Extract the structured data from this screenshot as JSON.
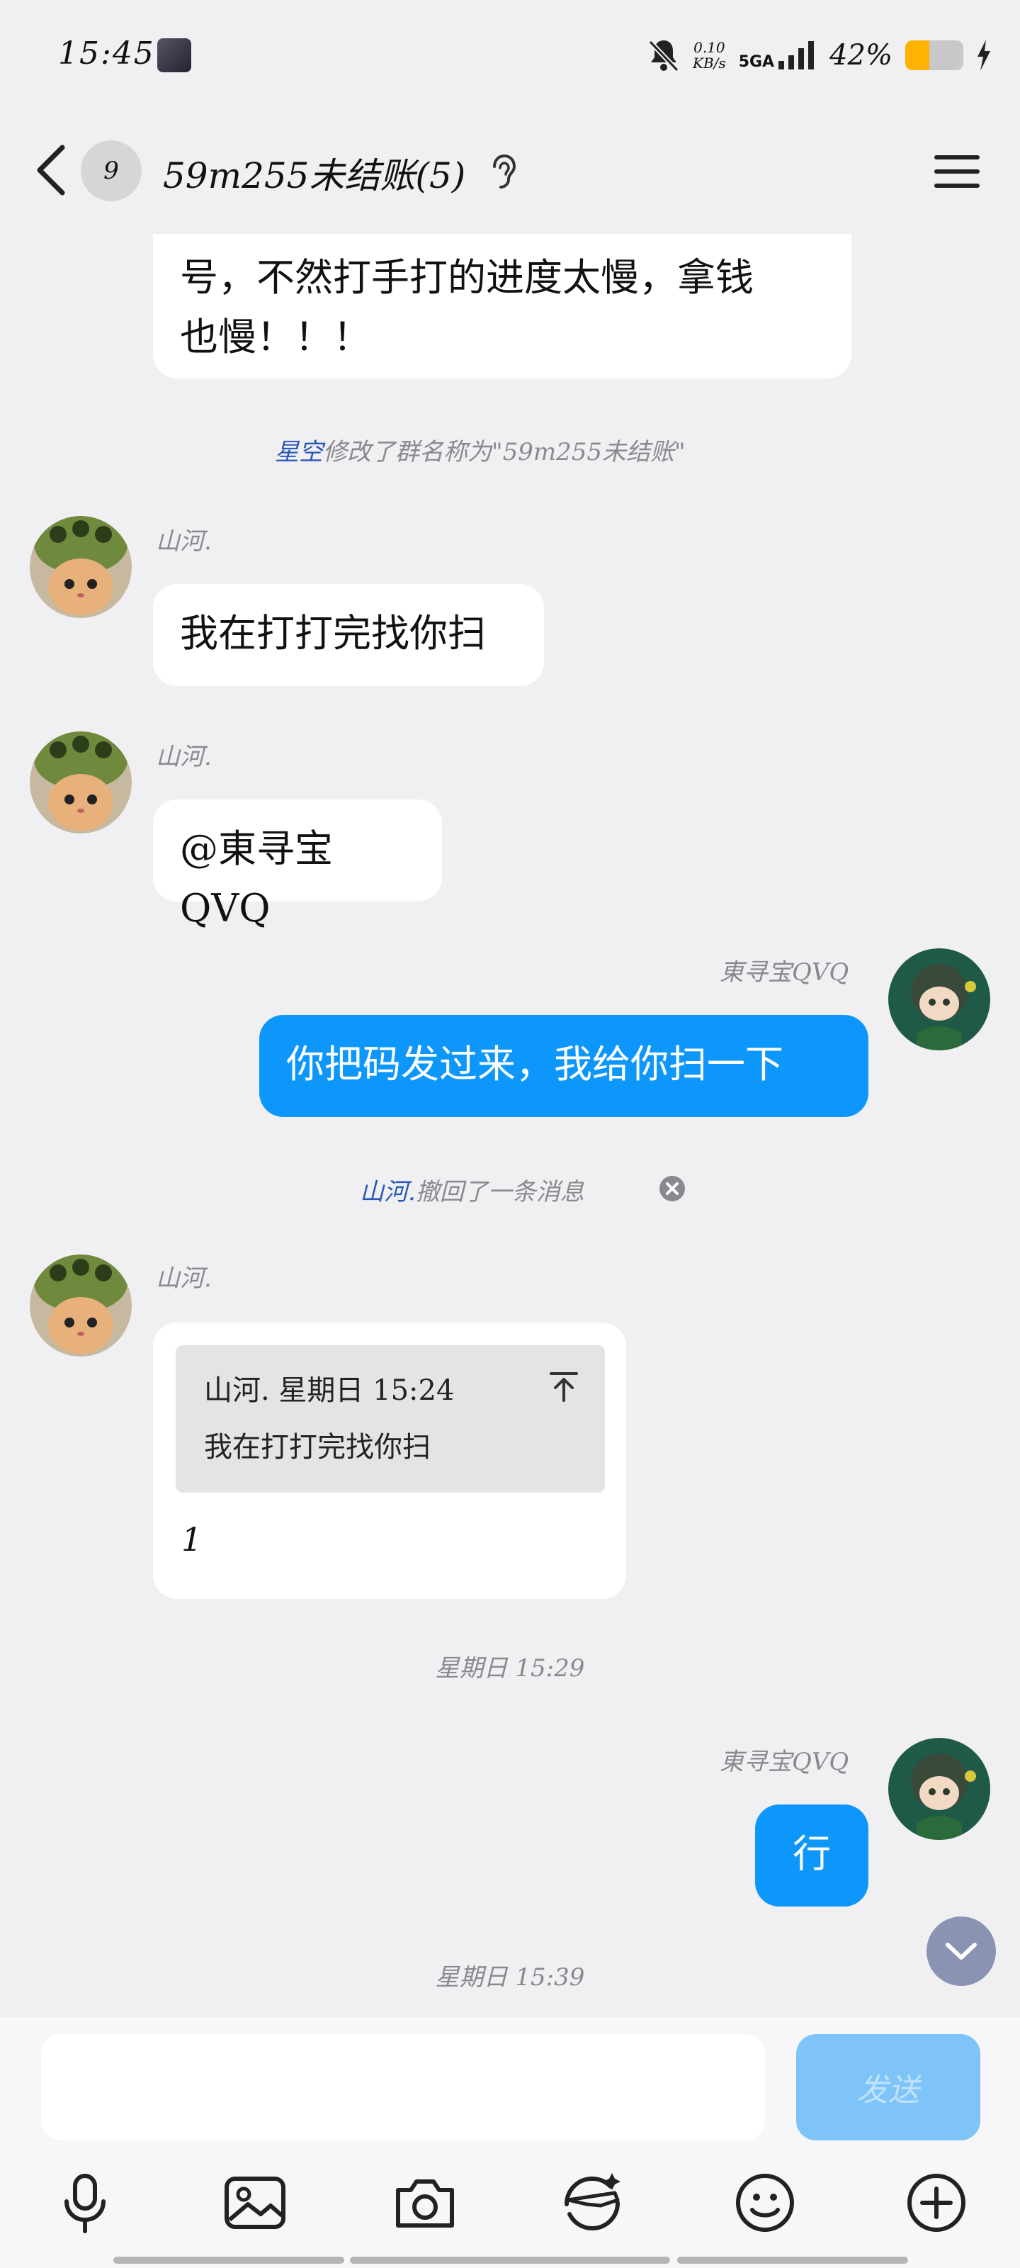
{
  "status_bar": {
    "time": "15:45",
    "net_speed_value": "0.10",
    "net_speed_unit": "KB/s",
    "network": "5GA",
    "battery_percent": "42%",
    "battery_level": 0.42
  },
  "header": {
    "unread_count": "9",
    "title": "59m255未结账(5)",
    "icons": [
      "back-icon",
      "ear-icon",
      "menu-icon"
    ]
  },
  "messages": {
    "partial_bubble": {
      "line1": "号，不然打手打的进度太慢，拿钱",
      "line2": "也慢！！！"
    },
    "rename_notice": {
      "actor": "星空",
      "text": "修改了群名称为\"59m255未结账\""
    },
    "msg1": {
      "sender": "山河.",
      "text": "我在打打完找你扫"
    },
    "msg2": {
      "sender": "山河.",
      "text": "@東寻宝QVQ"
    },
    "msg3": {
      "sender": "東寻宝QVQ",
      "text": "你把码发过来，我给你扫一下"
    },
    "recall_notice": {
      "actor": "山河.",
      "text": "撤回了一条消息"
    },
    "msg4": {
      "sender": "山河.",
      "quote_header": "山河. 星期日 15:24",
      "quote_text": "我在打打完找你扫",
      "text": "1"
    },
    "timestamp1": "星期日 15:29",
    "msg5": {
      "sender": "東寻宝QVQ",
      "text": "行"
    },
    "timestamp2": "星期日 15:39"
  },
  "input": {
    "placeholder": "",
    "send_label": "发送"
  },
  "toolbar": [
    "microphone-icon",
    "image-icon",
    "camera-icon",
    "sticker-icon",
    "emoji-icon",
    "plus-icon"
  ],
  "colors": {
    "background": "#f0f0f3",
    "my_bubble": "#0e97fa",
    "other_bubble": "#ffffff",
    "send_button": "#7fc4f8",
    "link": "#2a57b8"
  }
}
